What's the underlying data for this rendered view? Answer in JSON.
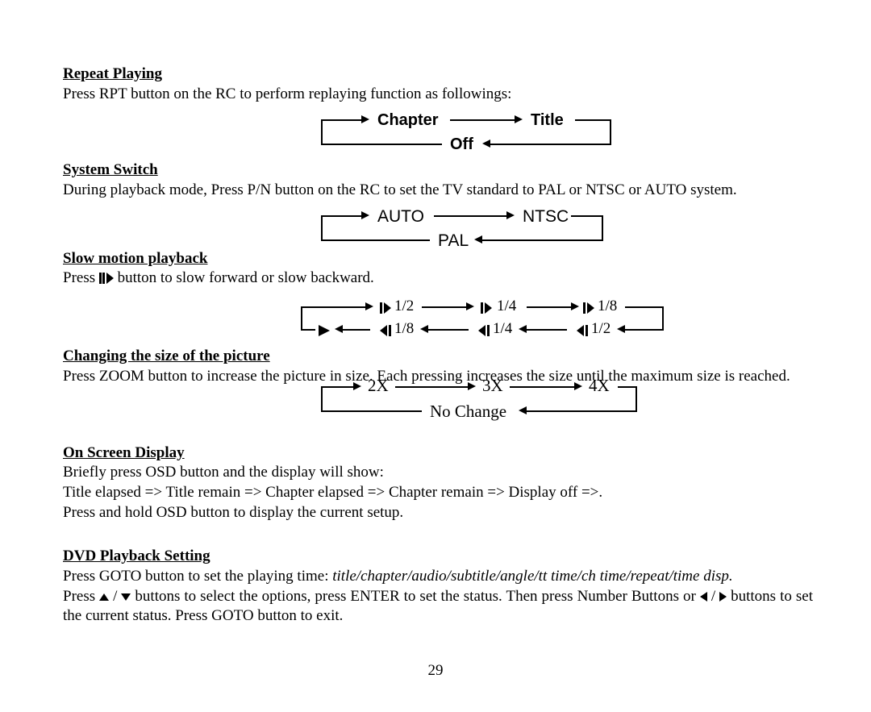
{
  "sections": {
    "repeat": {
      "heading": "Repeat Playing",
      "text": "Press RPT button on the RC to perform replaying function as followings:",
      "diagram": {
        "top": [
          "Chapter",
          "Title"
        ],
        "bottom": "Off"
      }
    },
    "system": {
      "heading": "System Switch",
      "text": "During playback mode, Press P/N button on the RC to set the TV standard to PAL or NTSC or AUTO system.",
      "diagram": {
        "top": [
          "AUTO",
          "NTSC"
        ],
        "bottom": "PAL"
      }
    },
    "slow": {
      "heading": "Slow motion playback",
      "text_prefix": "Press ",
      "text_suffix": " button to slow forward or slow backward.",
      "diagram": {
        "top": [
          "1/2",
          "1/4",
          "1/8"
        ],
        "bottom": [
          "1/8",
          "1/4",
          "1/2"
        ],
        "bottom_end": "▶"
      }
    },
    "zoom": {
      "heading": "Changing the size of the picture",
      "text": "Press ZOOM button to increase the picture in size. Each pressing increases the size until the maximum size is reached.",
      "diagram": {
        "top": [
          "2X",
          "3X",
          "4X"
        ],
        "bottom": "No Change"
      }
    },
    "osd": {
      "heading": "On Screen Display",
      "line1": "Briefly press OSD button and the display will show:",
      "line2": "Title elapsed => Title remain => Chapter elapsed => Chapter remain => Display off =>.",
      "line3": "Press and hold OSD button to display the current setup."
    },
    "goto": {
      "heading": "DVD Playback Setting",
      "line1_prefix": "Press GOTO button to set the playing time: ",
      "line1_italic": "title/chapter/audio/subtitle/angle/tt time/ch time/repeat/time disp.",
      "line2_a": "Press ",
      "line2_b": " buttons to select the options, press ENTER to set the status. Then press Number Buttons or ",
      "line2_c": " buttons to set the current status. Press GOTO button to exit."
    }
  },
  "page_number": "29"
}
